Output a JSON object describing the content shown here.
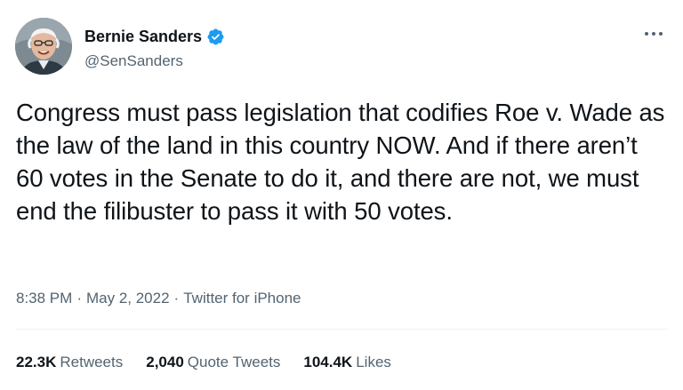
{
  "author": {
    "display_name": "Bernie Sanders",
    "handle": "@SenSanders",
    "avatar_icon": "bernie-sanders-avatar",
    "verified_icon": "verified-badge-icon",
    "verified_color": "#1d9bf0"
  },
  "tweet": {
    "text": "Congress must pass legislation that codifies Roe v. Wade as the law of the land in this country NOW. And if there aren’t 60 votes in the Senate to do it, and there are not, we must end the filibuster to pass it with 50 votes."
  },
  "meta": {
    "time": "8:38 PM",
    "separator": "·",
    "date": "May 2, 2022",
    "source": "Twitter for iPhone"
  },
  "stats": {
    "retweets": {
      "count": "22.3K",
      "label": "Retweets"
    },
    "quote_tweets": {
      "count": "2,040",
      "label": "Quote Tweets"
    },
    "likes": {
      "count": "104.4K",
      "label": "Likes"
    }
  },
  "colors": {
    "text_primary": "#0f1419",
    "text_secondary": "#536471",
    "divider": "#eff3f4"
  }
}
